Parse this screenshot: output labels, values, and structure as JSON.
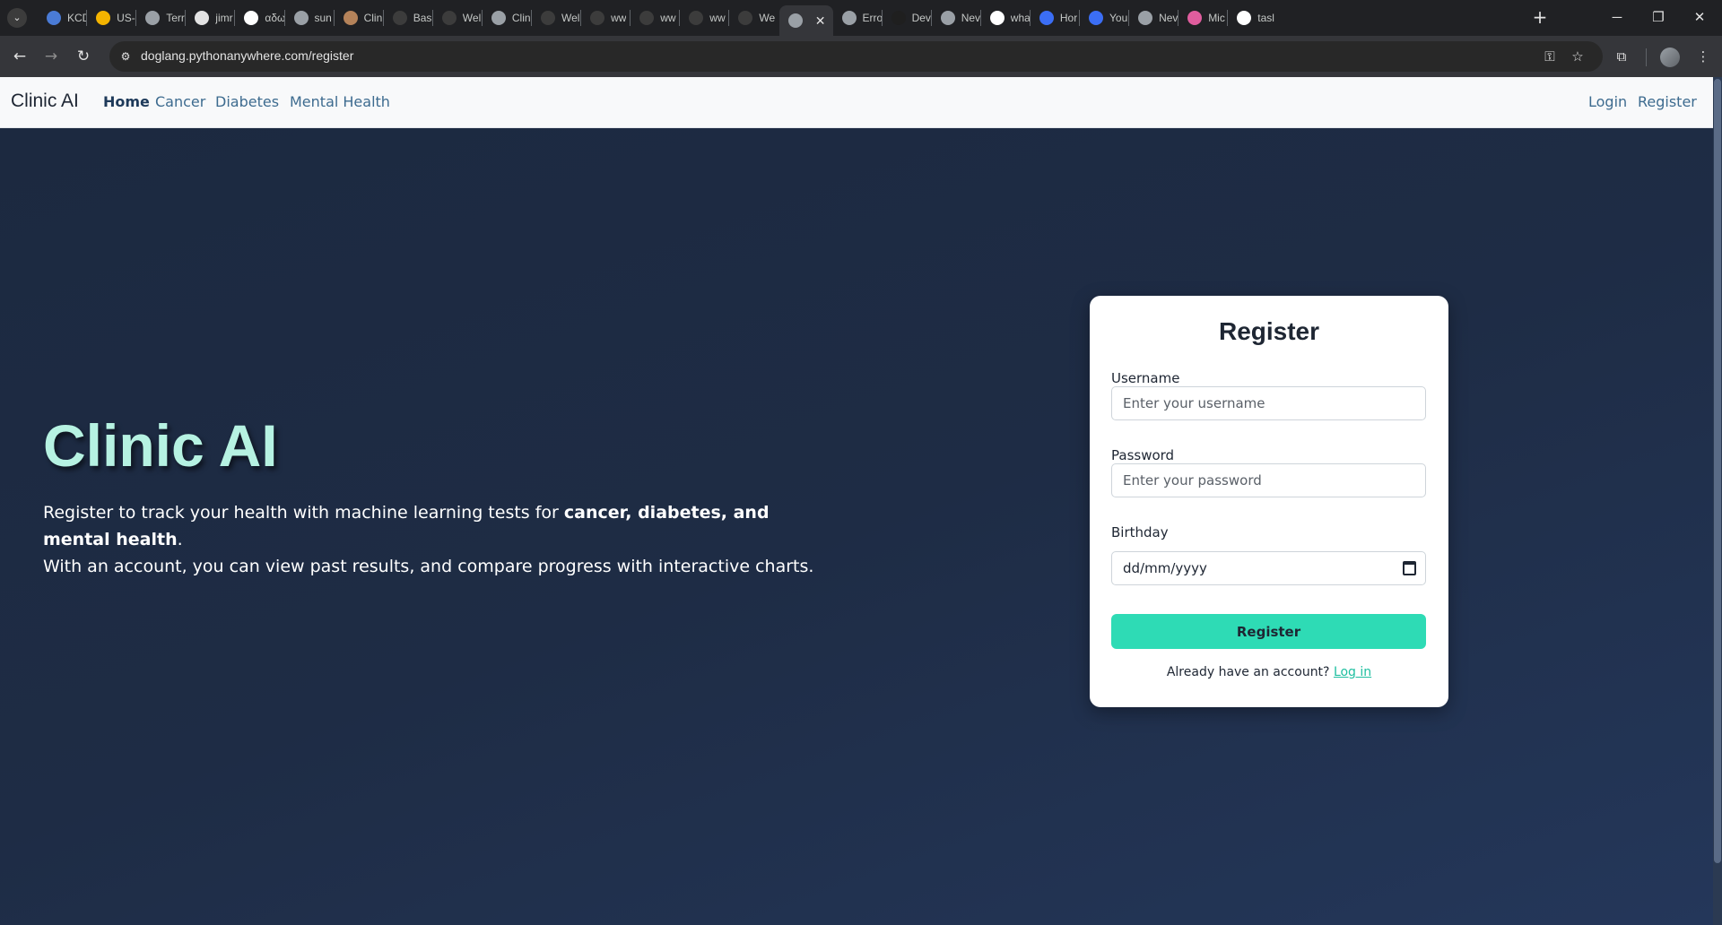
{
  "browser": {
    "tabs": [
      {
        "title": "KCD",
        "favicon": "globe-blue-icon",
        "color": "#4a7bd6"
      },
      {
        "title": "US-",
        "favicon": "drive-icon",
        "color": "#f4b400"
      },
      {
        "title": "Terr",
        "favicon": "globe-icon",
        "color": "#9aa0a6"
      },
      {
        "title": "jimr",
        "favicon": "github-icon",
        "color": "#e3e3e3"
      },
      {
        "title": "αδω",
        "favicon": "google-icon",
        "color": "#ffffff"
      },
      {
        "title": "sun",
        "favicon": "globe-icon",
        "color": "#9aa0a6"
      },
      {
        "title": "Clin",
        "favicon": "snake-icon",
        "color": "#b5835a"
      },
      {
        "title": "Basi",
        "favicon": "openai-icon",
        "color": "#3c3c3c"
      },
      {
        "title": "Wel",
        "favicon": "openai-icon",
        "color": "#3c3c3c"
      },
      {
        "title": "Clin",
        "favicon": "globe-icon",
        "color": "#9aa0a6"
      },
      {
        "title": "Wel",
        "favicon": "openai-icon",
        "color": "#3c3c3c"
      },
      {
        "title": "ww",
        "favicon": "openai-icon",
        "color": "#3c3c3c"
      },
      {
        "title": "ww",
        "favicon": "openai-icon",
        "color": "#3c3c3c"
      },
      {
        "title": "ww",
        "favicon": "openai-icon",
        "color": "#3c3c3c"
      },
      {
        "title": "We",
        "favicon": "openai-icon",
        "color": "#3c3c3c"
      },
      {
        "title": "",
        "favicon": "globe-icon",
        "color": "#9aa0a6",
        "active": true
      },
      {
        "title": "Erro",
        "favicon": "gear-icon",
        "color": "#9aa0a6"
      },
      {
        "title": "Dev",
        "favicon": "d-icon",
        "color": "#1f1f1f"
      },
      {
        "title": "Nev",
        "favicon": "chrome-icon",
        "color": "#9aa0a6"
      },
      {
        "title": "wha",
        "favicon": "google-icon",
        "color": "#ffffff"
      },
      {
        "title": "Hor",
        "favicon": "c-icon",
        "color": "#3b6ef5"
      },
      {
        "title": "You",
        "favicon": "c-icon",
        "color": "#3b6ef5"
      },
      {
        "title": "Nev",
        "favicon": "chrome-icon",
        "color": "#9aa0a6"
      },
      {
        "title": "Mic",
        "favicon": "copilot-icon",
        "color": "#e05d9e"
      },
      {
        "title": "tasl",
        "favicon": "google-icon",
        "color": "#ffffff"
      }
    ],
    "new_tab": "+",
    "url": "doglang.pythonanywhere.com/register"
  },
  "site": {
    "brand": "Clinic AI",
    "nav": [
      "Home",
      "Cancer",
      "Diabetes",
      "Mental Health"
    ],
    "login": "Login",
    "register": "Register"
  },
  "hero": {
    "title": "Clinic AI",
    "line1_prefix": "Register to track your health with machine learning tests for ",
    "line1_bold": "cancer, diabetes, and mental health",
    "line1_suffix": ".",
    "line2": "With an account, you can view past results, and compare progress with interactive charts."
  },
  "form": {
    "title": "Register",
    "username_label": "Username",
    "username_placeholder": "Enter your username",
    "password_label": "Password",
    "password_placeholder": "Enter your password",
    "birthday_label": "Birthday",
    "birthday_placeholder": "dd/mm/yyyy",
    "submit": "Register",
    "login_prompt": "Already have an account?",
    "login_link": "Log in"
  }
}
